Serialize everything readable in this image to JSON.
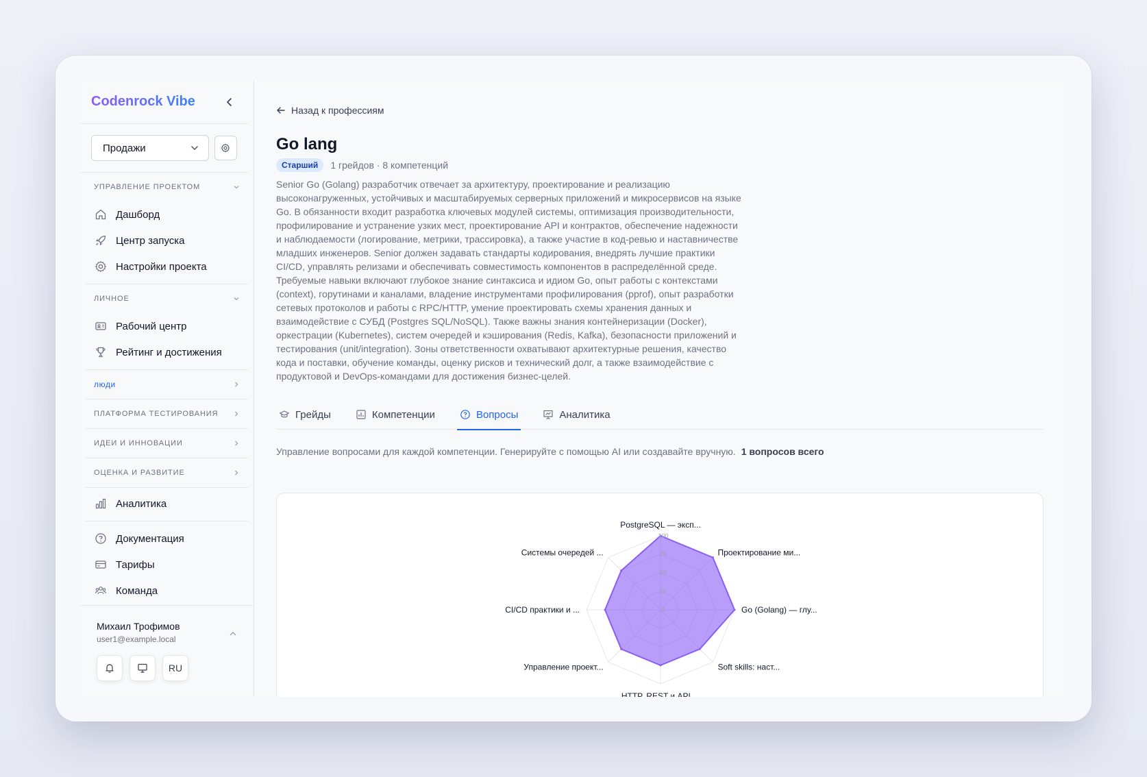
{
  "app": {
    "brand": "Codenrock Vibe",
    "project_select": "Продажи"
  },
  "sidebar": {
    "sections": [
      {
        "title": "УПРАВЛЕНИЕ ПРОЕКТОМ",
        "items": [
          {
            "label": "Дашборд",
            "icon": "home-icon"
          },
          {
            "label": "Центр запуска",
            "icon": "rocket-icon"
          },
          {
            "label": "Настройки проекта",
            "icon": "gear-icon"
          }
        ]
      },
      {
        "title": "ЛИЧНОЕ",
        "items": [
          {
            "label": "Рабочий центр",
            "icon": "id-card-icon"
          },
          {
            "label": "Рейтинг и достижения",
            "icon": "trophy-icon"
          }
        ]
      }
    ],
    "collapsed": [
      "ЛЮДИ",
      "ПЛАТФОРМА ТЕСТИРОВАНИЯ",
      "ИДЕИ И ИННОВАЦИИ",
      "ОЦЕНКА И РАЗВИТИЕ"
    ],
    "analytics": "Аналитика",
    "bottom_items": [
      "Документация",
      "Тарифы",
      "Команда"
    ],
    "user": {
      "name": "Михаил Трофимов",
      "email": "user1@example.local",
      "lang": "RU"
    }
  },
  "main": {
    "back_label": "Назад к профессиям",
    "title": "Go lang",
    "badge": "Старший",
    "meta": "1 грейдов · 8 компетенций",
    "description": "Senior Go (Golang) разработчик отвечает за архитектуру, проектирование и реализацию высоконагруженных, устойчивых и масштабируемых серверных приложений и микросервисов на языке Go. В обязанности входит разработка ключевых модулей системы, оптимизация производительности, профилирование и устранение узких мест, проектирование API и контрактов, обеспечение надежности и наблюдаемости (логирование, метрики, трассировка), а также участие в код-ревью и наставничестве младших инженеров. Senior должен задавать стандарты кодирования, внедрять лучшие практики CI/CD, управлять релизами и обеспечивать совместимость компонентов в распределённой среде. Требуемые навыки включают глубокое знание синтаксиса и идиом Go, опыт работы с контекстами (context), горутинами и каналами, владение инструментами профилирования (pprof), опыт разработки сетевых протоколов и работы с RPC/HTTP, умение проектировать схемы хранения данных и взаимодействие с СУБД (Postgres SQL/NoSQL). Также важны знания контейнеризации (Docker), оркестрации (Kubernetes), систем очередей и кэширования (Redis, Kafka), безопасности приложений и тестирования (unit/integration). Зоны ответственности охватывают архитектурные решения, качество кода и поставки, обучение команды, оценку рисков и технический долг, а также взаимодействие с продуктовой и DevOps-командами для достижения бизнес-целей.",
    "tabs": [
      {
        "label": "Грейды",
        "icon": "graduation-cap-icon"
      },
      {
        "label": "Компетенции",
        "icon": "chart-box-icon"
      },
      {
        "label": "Вопросы",
        "icon": "question-circle-icon"
      },
      {
        "label": "Аналитика",
        "icon": "presentation-chart-icon"
      }
    ],
    "active_tab": "Вопросы",
    "hint": "Управление вопросами для каждой компетенции. Генерируйте с помощью AI или создавайте вручную.",
    "total": "1 вопросов всего"
  },
  "chart_data": {
    "type": "radar",
    "categories": [
      "PostgreSQL — эксп...",
      "Проектирование ми...",
      "Go (Golang) — глу...",
      "Soft skills: наст...",
      "HTTP, REST и API ...",
      "Управление проект...",
      "CI/CD практики и ...",
      "Системы очередей ..."
    ],
    "values": [
      100,
      100,
      100,
      75,
      75,
      75,
      75,
      75
    ],
    "ticks": [
      "0",
      "25",
      "50",
      "75",
      "100"
    ],
    "range": [
      0,
      100
    ],
    "fill_color": "#8b5cf6",
    "grid": true
  }
}
